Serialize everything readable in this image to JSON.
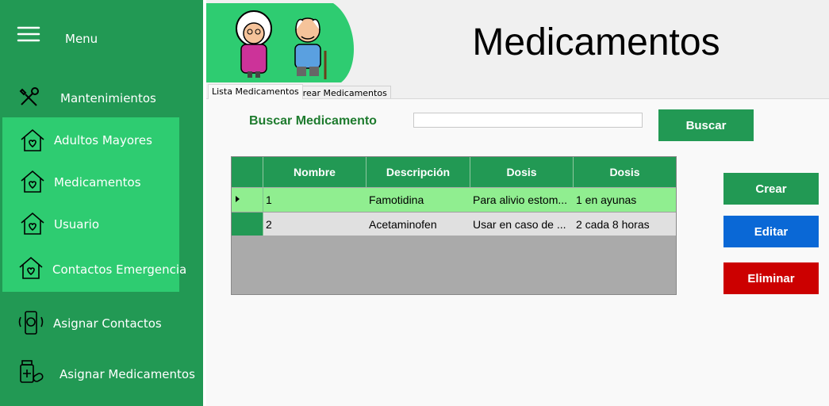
{
  "sidebar": {
    "menu_label": "Menu",
    "items": [
      {
        "label": "Mantenimientos",
        "icon": "tools-icon"
      },
      {
        "label": "Adultos Mayores",
        "icon": "house-heart-icon"
      },
      {
        "label": "Medicamentos",
        "icon": "house-heart-icon"
      },
      {
        "label": "Usuario",
        "icon": "house-heart-icon"
      },
      {
        "label": "Contactos Emergencia",
        "icon": "house-heart-icon"
      },
      {
        "label": "Asignar Contactos",
        "icon": "phone-contact-icon"
      },
      {
        "label": "Asignar Medicamentos",
        "icon": "medicine-bottle-icon"
      }
    ]
  },
  "header": {
    "title": "Medicamentos"
  },
  "tabs": [
    {
      "label": "Lista Medicamentos",
      "active": true
    },
    {
      "label": "Crear Medicamentos",
      "active": false
    }
  ],
  "search": {
    "label": "Buscar Medicamento",
    "value": "",
    "button": "Buscar"
  },
  "actions": {
    "crear": "Crear",
    "editar": "Editar",
    "eliminar": "Eliminar"
  },
  "grid": {
    "columns": [
      "Nombre",
      "Descripción",
      "Dosis",
      "Dosis"
    ],
    "rows": [
      {
        "cells": [
          "1",
          "Famotidina",
          "Para alivio estom...",
          "1 en ayunas"
        ],
        "selected": true
      },
      {
        "cells": [
          "2",
          "Acetaminofen",
          "Usar en caso de ...",
          "2 cada 8 horas"
        ],
        "selected": false
      }
    ]
  },
  "colors": {
    "sidebar": "#229954",
    "sidebar_highlight": "#2ecc71",
    "selected_row": "#90ee90",
    "edit_button": "#0a68d6",
    "delete_button": "#cc0000"
  }
}
